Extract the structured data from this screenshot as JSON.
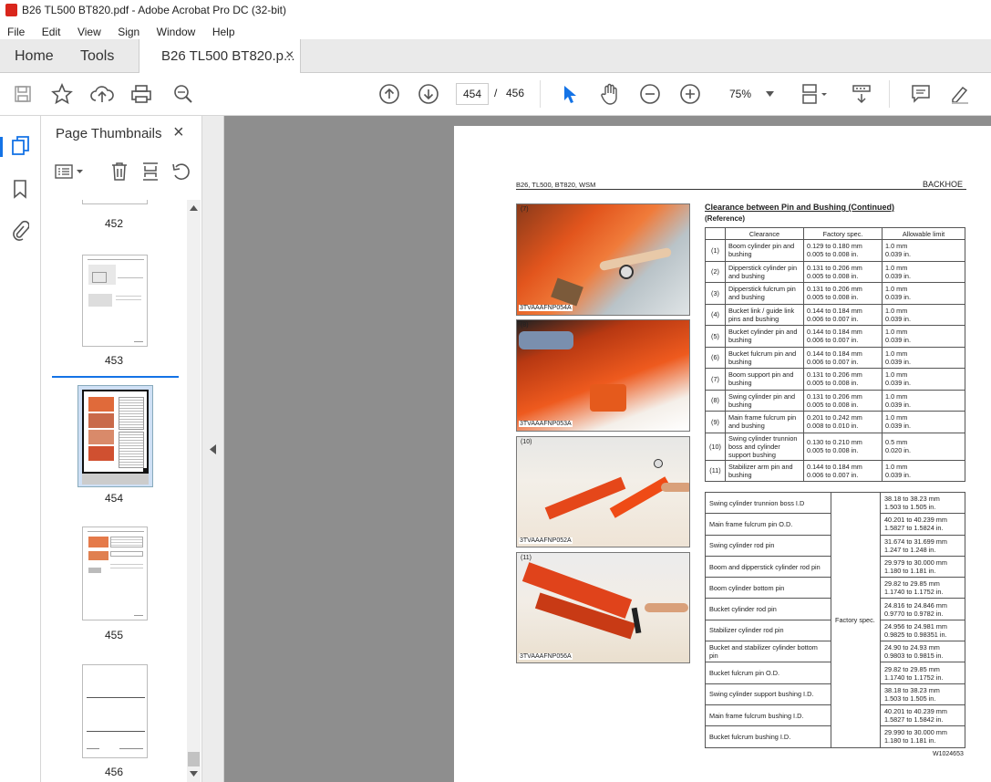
{
  "window": {
    "title": "B26 TL500 BT820.pdf - Adobe Acrobat Pro DC (32-bit)"
  },
  "menu": [
    "File",
    "Edit",
    "View",
    "Sign",
    "Window",
    "Help"
  ],
  "tabs": {
    "home": "Home",
    "tools": "Tools",
    "doc": "B26 TL500 BT820.p...",
    "close": "×"
  },
  "toolbar": {
    "page_current": "454",
    "page_sep": "/",
    "page_total": "456",
    "zoom": "75%"
  },
  "panel": {
    "title": "Page Thumbnails",
    "close": "×"
  },
  "thumbs": [
    {
      "label": "452"
    },
    {
      "label": "453"
    },
    {
      "label": "454"
    },
    {
      "label": "455"
    },
    {
      "label": "456"
    }
  ],
  "doc_page": {
    "header_left": "B26, TL500, BT820, WSM",
    "header_right": "BACKHOE",
    "section_title": "Clearance between Pin and Bushing (Continued)",
    "section_sub": "(Reference)",
    "photos": [
      {
        "num": "(7)",
        "caption": "3TVAAAFNP054A"
      },
      {
        "num": "(8)",
        "caption": "3TVAAAFNP053A"
      },
      {
        "num": "(10)",
        "caption": "3TVAAAFNP052A"
      },
      {
        "num": "(11)",
        "caption": "3TVAAAFNP056A"
      }
    ],
    "clearance_headers": [
      "Clearance",
      "Factory spec.",
      "Allowable limit"
    ],
    "clearance_rows": [
      {
        "n": "(1)",
        "item": "Boom cylinder pin and bushing",
        "spec1": "0.129 to 0.180 mm",
        "spec2": "0.005 to 0.008 in.",
        "lim1": "1.0 mm",
        "lim2": "0.039 in."
      },
      {
        "n": "(2)",
        "item": "Dipperstick cylinder pin and bushing",
        "spec1": "0.131 to 0.206 mm",
        "spec2": "0.005 to 0.008 in.",
        "lim1": "1.0 mm",
        "lim2": "0.039 in."
      },
      {
        "n": "(3)",
        "item": "Dipperstick fulcrum pin and bushing",
        "spec1": "0.131 to 0.206 mm",
        "spec2": "0.005 to 0.008 in.",
        "lim1": "1.0 mm",
        "lim2": "0.039 in."
      },
      {
        "n": "(4)",
        "item": "Bucket link / guide link pins and bushing",
        "spec1": "0.144 to 0.184 mm",
        "spec2": "0.006 to 0.007 in.",
        "lim1": "1.0 mm",
        "lim2": "0.039 in."
      },
      {
        "n": "(5)",
        "item": "Bucket cylinder pin and bushing",
        "spec1": "0.144 to 0.184 mm",
        "spec2": "0.006 to 0.007 in.",
        "lim1": "1.0 mm",
        "lim2": "0.039 in."
      },
      {
        "n": "(6)",
        "item": "Bucket fulcrum pin and bushing",
        "spec1": "0.144 to 0.184 mm",
        "spec2": "0.006 to 0.007 in.",
        "lim1": "1.0 mm",
        "lim2": "0.039 in."
      },
      {
        "n": "(7)",
        "item": "Boom support pin and bushing",
        "spec1": "0.131 to 0.206 mm",
        "spec2": "0.005 to 0.008 in.",
        "lim1": "1.0 mm",
        "lim2": "0.039 in."
      },
      {
        "n": "(8)",
        "item": "Swing cylinder pin and bushing",
        "spec1": "0.131 to 0.206 mm",
        "spec2": "0.005 to 0.008 in.",
        "lim1": "1.0 mm",
        "lim2": "0.039 in."
      },
      {
        "n": "(9)",
        "item": "Main frame fulcrum pin and bushing",
        "spec1": "0.201 to 0.242 mm",
        "spec2": "0.008 to 0.010 in.",
        "lim1": "1.0 mm",
        "lim2": "0.039 in."
      },
      {
        "n": "(10)",
        "item": "Swing cylinder trunnion boss and cylinder support bushing",
        "spec1": "0.130 to 0.210 mm",
        "spec2": "0.005 to 0.008 in.",
        "lim1": "0.5 mm",
        "lim2": "0.020 in."
      },
      {
        "n": "(11)",
        "item": "Stabilizer arm pin and bushing",
        "spec1": "0.144 to 0.184 mm",
        "spec2": "0.006 to 0.007 in.",
        "lim1": "1.0 mm",
        "lim2": "0.039 in."
      }
    ],
    "spec_label": "Factory spec.",
    "spec_rows": [
      {
        "item": "Swing cylinder trunnion boss I.D",
        "v1": "38.18 to 38.23 mm",
        "v2": "1.503 to 1.505 in."
      },
      {
        "item": "Main frame fulcrum pin O.D.",
        "v1": "40.201 to 40.239 mm",
        "v2": "1.5827 to 1.5824 in."
      },
      {
        "item": "Swing cylinder rod pin",
        "v1": "31.674 to 31.699 mm",
        "v2": "1.247 to 1.248 in."
      },
      {
        "item": "Boom and dipperstick cylinder rod pin",
        "v1": "29.979 to 30.000 mm",
        "v2": "1.180 to 1.181 in."
      },
      {
        "item": "Boom cylinder bottom pin",
        "v1": "29.82 to 29.85 mm",
        "v2": "1.1740 to 1.1752 in."
      },
      {
        "item": "Bucket cylinder rod pin",
        "v1": "24.816 to 24.846 mm",
        "v2": "0.9770 to 0.9782 in."
      },
      {
        "item": "Stabilizer cylinder rod pin",
        "v1": "24.956 to 24.981 mm",
        "v2": "0.9825 to 0.98351 in."
      },
      {
        "item": "Bucket and stabilizer cylinder bottom pin",
        "v1": "24.90 to 24.93 mm",
        "v2": "0.9803 to 0.9815 in."
      },
      {
        "item": "Bucket fulcrum pin O.D.",
        "v1": "29.82 to 29.85 mm",
        "v2": "1.1740 to 1.1752 in."
      },
      {
        "item": "Swing cylinder support bushing I.D.",
        "v1": "38.18 to 38.23 mm",
        "v2": "1.503 to 1.505 in."
      },
      {
        "item": "Main frame fulcrum bushing I.D.",
        "v1": "40.201 to 40.239 mm",
        "v2": "1.5827 to 1.5842 in."
      },
      {
        "item": "Bucket fulcrum bushing I.D.",
        "v1": "29.990 to 30.000 mm",
        "v2": "1.180 to 1.181 in."
      }
    ],
    "footer_code": "W1024653"
  }
}
